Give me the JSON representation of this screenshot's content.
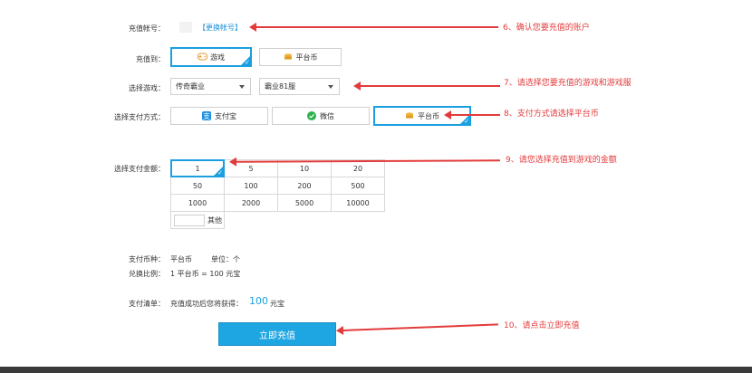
{
  "account": {
    "label": "充值帐号：",
    "change_link": "【更换帐号】"
  },
  "recharge_to": {
    "label": "充值到：",
    "options": [
      {
        "label": "游戏",
        "icon": "gamepad-icon",
        "selected": true
      },
      {
        "label": "平台币",
        "icon": "coin-stack-icon",
        "selected": false
      }
    ]
  },
  "game_select": {
    "label": "选择游戏：",
    "game_value": "传奇霸业",
    "server_value": "霸业81服"
  },
  "payment_method": {
    "label": "选择支付方式：",
    "options": [
      {
        "label": "支付宝",
        "icon": "alipay-icon",
        "selected": false
      },
      {
        "label": "微信",
        "icon": "wechat-icon",
        "selected": false
      },
      {
        "label": "平台币",
        "icon": "coin-stack-icon",
        "selected": true
      }
    ]
  },
  "amount": {
    "label": "选择支付金额：",
    "rows": [
      [
        "1",
        "5",
        "10",
        "20"
      ],
      [
        "50",
        "100",
        "200",
        "500"
      ],
      [
        "1000",
        "2000",
        "5000",
        "10000"
      ]
    ],
    "selected": "1",
    "other_label": "其他"
  },
  "summary": {
    "currency_label": "支付币种：",
    "currency_value": "平台币",
    "unit_label": "单位：个",
    "ratio_label": "兑换比例：",
    "ratio_value": "1 平台币 = 100 元宝",
    "bill_label": "支付清单：",
    "bill_text": "充值成功后您将获得：",
    "bill_amount": "100",
    "bill_unit": "元宝"
  },
  "submit_label": "立即充值",
  "annotations": [
    {
      "id": "6",
      "text": "6、确认您要充值的账户"
    },
    {
      "id": "7",
      "text": "7、请选择您要充值的游戏和游戏服"
    },
    {
      "id": "8",
      "text": "8、支付方式请选择平台币"
    },
    {
      "id": "9",
      "text": "9、请您选择充值到游戏的金额"
    },
    {
      "id": "10",
      "text": "10、请点击立即充值"
    }
  ],
  "colors": {
    "accent": "#1a9fdf",
    "annotation": "#e33b3b",
    "button": "#1ea6e3"
  }
}
